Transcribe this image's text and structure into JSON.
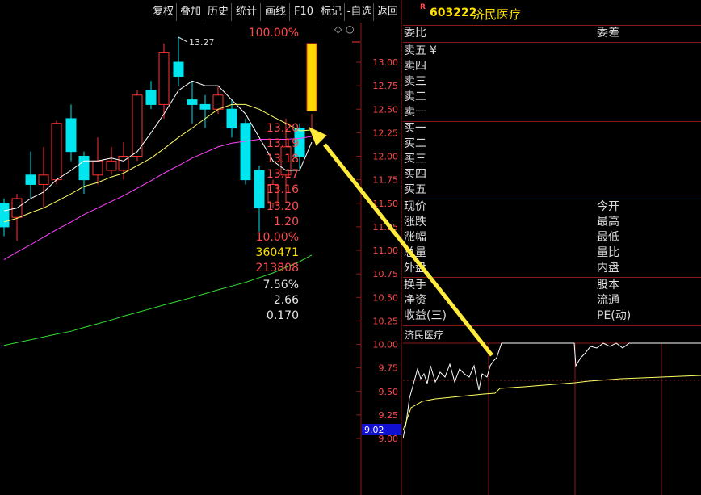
{
  "toolbar": {
    "items": [
      "复权",
      "叠加",
      "历史",
      "统计",
      "画线",
      "F10",
      "标记",
      "-自选",
      "返回"
    ]
  },
  "stock": {
    "marker": "R",
    "code": "603222",
    "name": "济民医疗"
  },
  "weibi": {
    "label": "委比",
    "value": "100.00%",
    "label2": "委差"
  },
  "sell_orders": [
    {
      "label": "卖五",
      "price": "¥"
    },
    {
      "label": "卖四",
      "price": ""
    },
    {
      "label": "卖三",
      "price": ""
    },
    {
      "label": "卖二",
      "price": ""
    },
    {
      "label": "卖一",
      "price": ""
    }
  ],
  "buy_orders": [
    {
      "label": "买一",
      "price": "13.20"
    },
    {
      "label": "买二",
      "price": "13.19"
    },
    {
      "label": "买三",
      "price": "13.18"
    },
    {
      "label": "买四",
      "price": "13.17"
    },
    {
      "label": "买五",
      "price": "13.16"
    }
  ],
  "quote_rows": [
    {
      "label": "现价",
      "value": "13.20",
      "label2": "今开",
      "color": "#ff4b4b"
    },
    {
      "label": "涨跌",
      "value": "1.20",
      "label2": "最高",
      "color": "#ff4b4b"
    },
    {
      "label": "涨幅",
      "value": "10.00%",
      "label2": "最低",
      "color": "#ff4b4b"
    },
    {
      "label": "总量",
      "value": "360471",
      "label2": "量比",
      "color": "#ffe000"
    },
    {
      "label": "外盘",
      "value": "213808",
      "label2": "内盘",
      "color": "#ff4b4b"
    }
  ],
  "fund_rows": [
    {
      "label": "换手",
      "value": "7.56%",
      "label2": "股本"
    },
    {
      "label": "净资",
      "value": "2.66",
      "label2": "流通"
    },
    {
      "label": "收益(三)",
      "value": "0.170",
      "label2": "PE(动)"
    }
  ],
  "kline": {
    "high_marker": "13.27",
    "current_price_tag": "9.02",
    "price_axis": [
      "13.00",
      "12.75",
      "12.50",
      "12.25",
      "12.00",
      "11.75",
      "11.50",
      "11.25",
      "11.00",
      "10.75",
      "10.50",
      "10.25",
      "10.00",
      "9.75",
      "9.50",
      "9.25",
      "9.00"
    ]
  },
  "intraday": {
    "title": "济民医疗"
  },
  "colors": {
    "up": "#ff3232",
    "down": "#00e5ee",
    "ma5": "#ffffff",
    "ma10": "#ffff66",
    "ma20": "#ff40ff",
    "ma60": "#33dd33",
    "limit_up": "#ffd800",
    "arrow": "#ffeb3b"
  }
}
